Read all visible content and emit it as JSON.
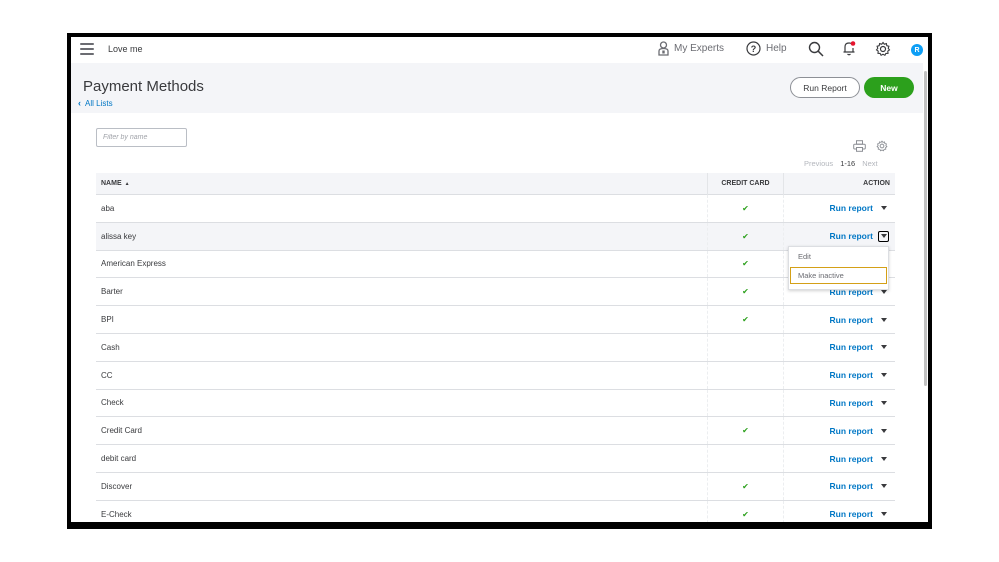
{
  "topbar": {
    "company_name": "Love me",
    "my_experts_label": "My Experts",
    "help_label": "Help",
    "avatar_initial": "R",
    "notification_dot_color": "#e5142e"
  },
  "page": {
    "title": "Payment Methods",
    "back_link": "All Lists",
    "run_report_button": "Run Report",
    "new_button": "New"
  },
  "filter": {
    "placeholder": "Filter by name",
    "value": ""
  },
  "pager": {
    "previous": "Previous",
    "range": "1-16",
    "next": "Next"
  },
  "table": {
    "columns": {
      "name": "NAME",
      "credit_card": "CREDIT CARD",
      "action": "ACTION"
    },
    "sort": "ascending",
    "action_label": "Run report",
    "rows": [
      {
        "name": "aba",
        "credit_card": true
      },
      {
        "name": "alissa key",
        "credit_card": true
      },
      {
        "name": "American Express",
        "credit_card": true
      },
      {
        "name": "Barter",
        "credit_card": true
      },
      {
        "name": "BPI",
        "credit_card": true
      },
      {
        "name": "Cash",
        "credit_card": false
      },
      {
        "name": "CC",
        "credit_card": false
      },
      {
        "name": "Check",
        "credit_card": false
      },
      {
        "name": "Credit Card",
        "credit_card": true
      },
      {
        "name": "debit card",
        "credit_card": false
      },
      {
        "name": "Discover",
        "credit_card": true
      },
      {
        "name": "E-Check",
        "credit_card": true
      }
    ]
  },
  "dropdown": {
    "open_for_row": 1,
    "items": [
      "Edit",
      "Make inactive"
    ],
    "focused_item": 1
  },
  "colors": {
    "accent_green": "#2ca01c",
    "link_blue": "#0077c5",
    "avatar_blue": "#0d9ef5",
    "focus_outline": "#d4a017"
  }
}
